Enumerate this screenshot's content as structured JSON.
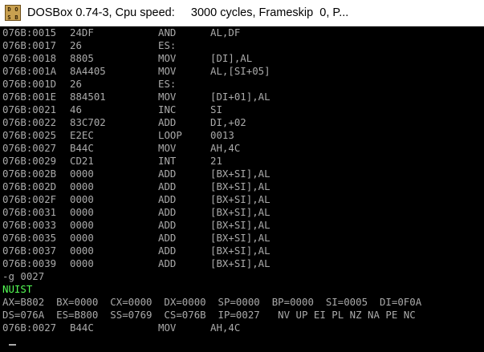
{
  "window": {
    "title": "DOSBox 0.74-3, Cpu speed:     3000 cycles, Frameskip  0, P...",
    "icon": "dosbox-icon",
    "icon_letters": [
      "D",
      "O",
      "S",
      "B"
    ]
  },
  "disasm": [
    {
      "addr": "076B:0015",
      "hex": "24DF",
      "op": "AND",
      "arg": "AL,DF"
    },
    {
      "addr": "076B:0017",
      "hex": "26",
      "op": "ES:",
      "arg": ""
    },
    {
      "addr": "076B:0018",
      "hex": "8805",
      "op": "MOV",
      "arg": "[DI],AL"
    },
    {
      "addr": "076B:001A",
      "hex": "8A4405",
      "op": "MOV",
      "arg": "AL,[SI+05]"
    },
    {
      "addr": "076B:001D",
      "hex": "26",
      "op": "ES:",
      "arg": ""
    },
    {
      "addr": "076B:001E",
      "hex": "884501",
      "op": "MOV",
      "arg": "[DI+01],AL"
    },
    {
      "addr": "076B:0021",
      "hex": "46",
      "op": "INC",
      "arg": "SI"
    },
    {
      "addr": "076B:0022",
      "hex": "83C702",
      "op": "ADD",
      "arg": "DI,+02"
    },
    {
      "addr": "076B:0025",
      "hex": "E2EC",
      "op": "LOOP",
      "arg": "0013"
    },
    {
      "addr": "076B:0027",
      "hex": "B44C",
      "op": "MOV",
      "arg": "AH,4C"
    },
    {
      "addr": "076B:0029",
      "hex": "CD21",
      "op": "INT",
      "arg": "21"
    },
    {
      "addr": "076B:002B",
      "hex": "0000",
      "op": "ADD",
      "arg": "[BX+SI],AL"
    },
    {
      "addr": "076B:002D",
      "hex": "0000",
      "op": "ADD",
      "arg": "[BX+SI],AL"
    },
    {
      "addr": "076B:002F",
      "hex": "0000",
      "op": "ADD",
      "arg": "[BX+SI],AL"
    },
    {
      "addr": "076B:0031",
      "hex": "0000",
      "op": "ADD",
      "arg": "[BX+SI],AL"
    },
    {
      "addr": "076B:0033",
      "hex": "0000",
      "op": "ADD",
      "arg": "[BX+SI],AL"
    },
    {
      "addr": "076B:0035",
      "hex": "0000",
      "op": "ADD",
      "arg": "[BX+SI],AL"
    },
    {
      "addr": "076B:0037",
      "hex": "0000",
      "op": "ADD",
      "arg": "[BX+SI],AL"
    },
    {
      "addr": "076B:0039",
      "hex": "0000",
      "op": "ADD",
      "arg": "[BX+SI],AL"
    }
  ],
  "command": "-g 0027",
  "program_output": "NUIST",
  "program_output_color": "#55ff55",
  "registers_line1": "AX=B802  BX=0000  CX=0000  DX=0000  SP=0000  BP=0000  SI=0005  DI=0F0A",
  "registers_line2": "DS=076A  ES=B800  SS=0769  CS=076B  IP=0027   NV UP EI PL NZ NA PE NC",
  "current_instr": {
    "addr": "076B:0027",
    "hex": "B44C",
    "op": "MOV",
    "arg": "AH,4C"
  },
  "prompt": "-",
  "colors": {
    "terminal_bg": "#000000",
    "terminal_text": "#aaaaaa"
  }
}
